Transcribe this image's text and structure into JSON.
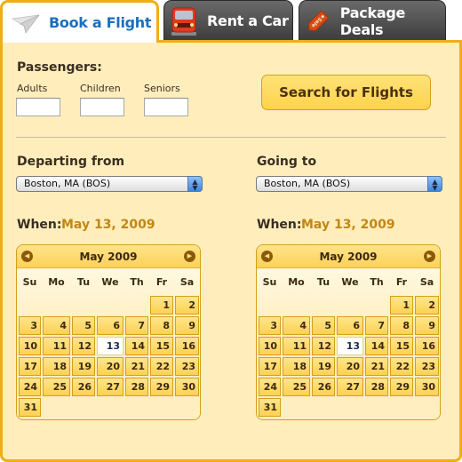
{
  "tabs": [
    {
      "id": "book-flight",
      "label": "Book a Flight",
      "icon": "paper-plane-icon",
      "active": true
    },
    {
      "id": "rent-car",
      "label": "Rent a Car",
      "icon": "red-car-icon",
      "active": false
    },
    {
      "id": "package-deals",
      "label": "Package Deals",
      "icon": "sale-tag-icon",
      "active": false,
      "icon_text": "Sale"
    }
  ],
  "passengers": {
    "title": "Passengers:",
    "adults": {
      "label": "Adults",
      "value": ""
    },
    "children": {
      "label": "Children",
      "value": ""
    },
    "seniors": {
      "label": "Seniors",
      "value": ""
    }
  },
  "search_button": "Search for Flights",
  "departing": {
    "label": "Departing from",
    "value": "Boston, MA (BOS)",
    "when_label": "When:",
    "when_date": "May 13, 2009"
  },
  "going": {
    "label": "Going to",
    "value": "Boston, MA (BOS)",
    "when_label": "When:",
    "when_date": "May 13, 2009"
  },
  "calendar": {
    "month_label": "May 2009",
    "weekdays": [
      "Su",
      "Mo",
      "Tu",
      "We",
      "Th",
      "Fr",
      "Sa"
    ],
    "first_weekday_index": 5,
    "days_in_month": 31,
    "selected_day": 13,
    "prev_icon": "circle-left-arrow-icon",
    "next_icon": "circle-right-arrow-icon"
  },
  "colors": {
    "accent_orange": "#f0ad17",
    "panel_bg": "#ffeebc",
    "tab_active_text": "#1a6fc0",
    "date_text": "#c28614"
  }
}
